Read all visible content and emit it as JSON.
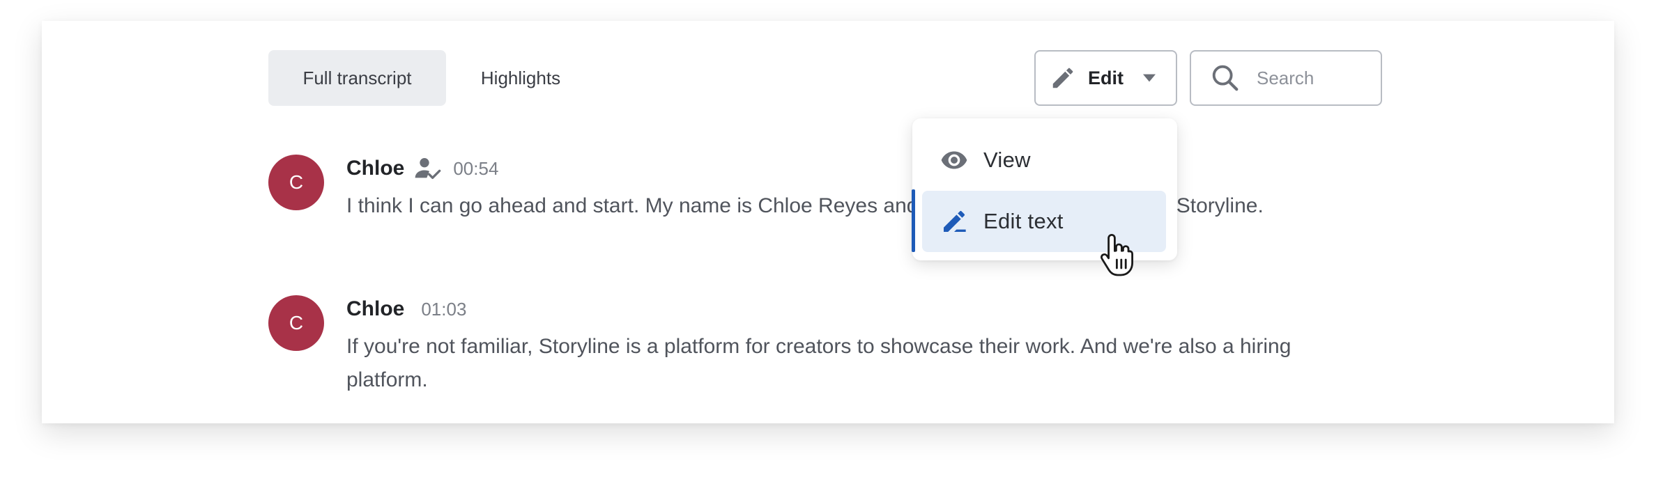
{
  "tabs": [
    {
      "label": "Full transcript",
      "active": true
    },
    {
      "label": "Highlights",
      "active": false
    }
  ],
  "edit_button": {
    "label": "Edit",
    "icon": "pencil-icon"
  },
  "search": {
    "placeholder": "Search",
    "value": "",
    "icon": "search-icon"
  },
  "transcript": [
    {
      "avatar": "C",
      "speaker": "Chloe",
      "speaker_icon": "verified-speaker-icon",
      "time": "00:54",
      "text": "I think I can go ahead and start. My name is Chloe Reyes and I lead people operations at Storyline."
    },
    {
      "avatar": "C",
      "speaker": "Chloe",
      "time": "01:03",
      "text": "If you're not familiar, Storyline is a platform for creators to showcase their work. And we're also a hiring platform."
    }
  ],
  "menu": {
    "items": [
      {
        "label": "View",
        "icon": "eye-icon"
      },
      {
        "label": "Edit text",
        "icon": "pencil-icon",
        "highlighted": true
      }
    ]
  },
  "colors": {
    "avatar": "#a83248",
    "accent": "#1e5bb8",
    "highlight": "#e6eef8",
    "active_tab": "#ebedf0"
  }
}
